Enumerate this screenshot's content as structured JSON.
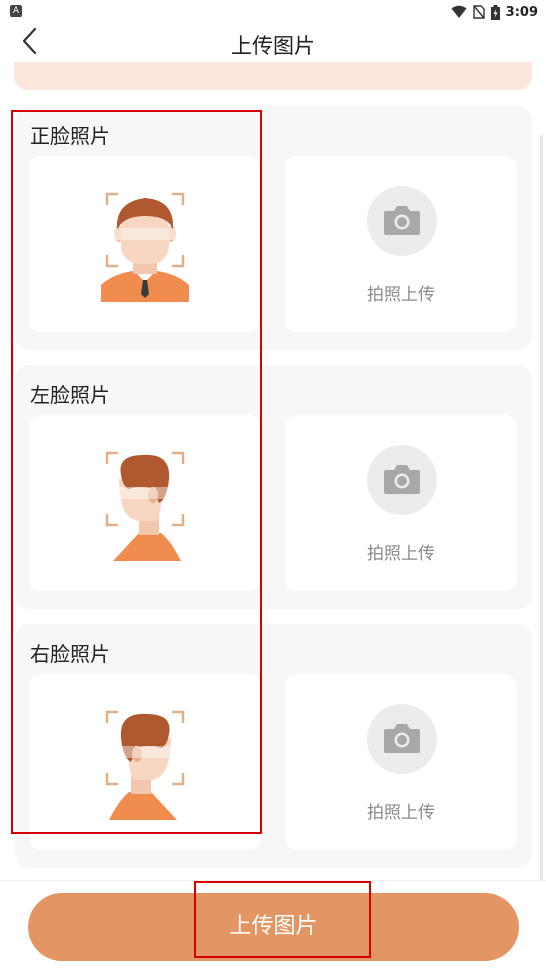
{
  "status_bar": {
    "app_badge": "A",
    "time": "3:09",
    "icons": [
      "wifi-icon",
      "no-sim-icon",
      "battery-icon"
    ]
  },
  "nav": {
    "back_icon": "chevron-left-icon",
    "title": "上传图片"
  },
  "sections": [
    {
      "title": "正脸照片",
      "sample": "front-face-sample",
      "camera_label": "拍照上传"
    },
    {
      "title": "左脸照片",
      "sample": "left-face-sample",
      "camera_label": "拍照上传"
    },
    {
      "title": "右脸照片",
      "sample": "right-face-sample",
      "camera_label": "拍照上传"
    }
  ],
  "bottom": {
    "upload_label": "上传图片"
  },
  "colors": {
    "accent": "#e39664",
    "peach_banner": "#fde6dc",
    "card_bg": "#f7f7f7",
    "camera_circle": "#ececec",
    "hair": "#b0582e",
    "skin": "#f8d6c2",
    "shirt": "#f08c4e",
    "annotation_red": "#d60000"
  }
}
